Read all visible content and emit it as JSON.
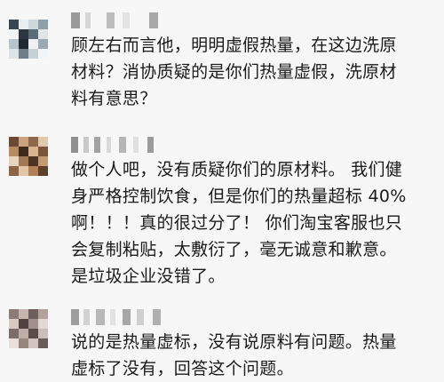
{
  "comments": [
    {
      "username": "",
      "text": "顾左右而言他，明明虚假热量，在这边洗原\n材料？消协质疑的是你们热量虚假，洗原材\n料有意思？"
    },
    {
      "username": "",
      "text": "做个人吧，没有质疑你们的原材料。 我们健\n身严格控制饮食，但是你们的热量超标 40%\n啊！！！真的很过分了！ 你们淘宝客服也只\n会复制粘贴，太敷衍了，毫无诚意和歉意。\n是垃圾企业没错了。"
    },
    {
      "username": "",
      "text": "说的是热量虚标，没有说原料有问题。热量\n虚标了没有，回答这个问题。"
    }
  ],
  "colors": {
    "background": "#f7f7f7",
    "text": "#1a1a1a"
  }
}
